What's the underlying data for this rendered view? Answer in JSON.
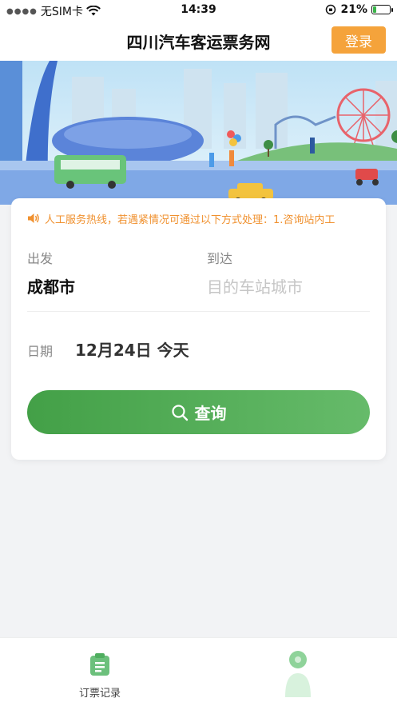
{
  "status_bar": {
    "carrier": "无SIM卡",
    "time": "14:39",
    "battery": "21%",
    "battery_level": 0.21
  },
  "header": {
    "title": "四川汽车客运票务网",
    "login_label": "登录"
  },
  "search_card": {
    "notice": "人工服务热线，若遇紧情况可通过以下方式处理：1.咨询站内工",
    "depart_label": "出发",
    "depart_city": "成都市",
    "arrive_label": "到达",
    "arrive_placeholder": "目的车站城市",
    "date_label": "日期",
    "date_value": "12月24日 今天",
    "search_label": "查询"
  },
  "tab_bar": {
    "orders_label": "订票记录"
  },
  "colors": {
    "accent_green": "#4caf50",
    "login_orange": "#f5a33b",
    "notice_orange": "#f0912f"
  }
}
